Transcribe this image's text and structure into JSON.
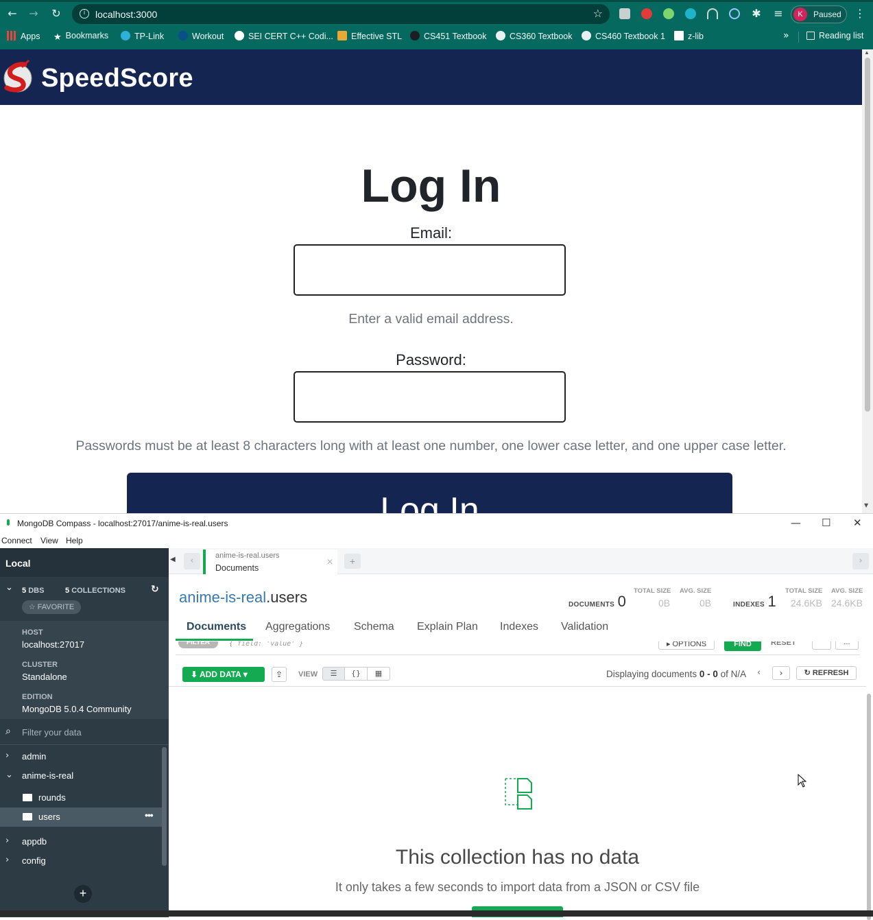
{
  "browser": {
    "url": "localhost:3000",
    "profile_initial": "K",
    "profile_status": "Paused",
    "bookmarks": [
      {
        "label": "Apps",
        "icon": "apps-grid-icon"
      },
      {
        "label": "Bookmarks",
        "icon": "star-icon"
      },
      {
        "label": "TP-Link",
        "icon": "tplink-icon"
      },
      {
        "label": "Workout",
        "icon": "workout-icon"
      },
      {
        "label": "SEI CERT C++ Codi...",
        "icon": "sei-icon"
      },
      {
        "label": "Effective STL",
        "icon": "book-icon"
      },
      {
        "label": "CS451 Textbook",
        "icon": "github-icon"
      },
      {
        "label": "CS360 Textbook",
        "icon": "globe-icon"
      },
      {
        "label": "CS460 Textbook 1",
        "icon": "globe-icon"
      },
      {
        "label": "z-lib",
        "icon": "zlib-icon"
      }
    ],
    "reading_list": "Reading list",
    "accent": "#05695f"
  },
  "site": {
    "brand": "SpeedScore",
    "navbar_color": "#152551",
    "title": "Log In",
    "email_label": "Email:",
    "email_help": "Enter a valid email address.",
    "password_label": "Password:",
    "password_help": "Passwords must be at least 8 characters long with at least one number, one lower case letter, and one upper case letter.",
    "login_button": "Log In"
  },
  "compass": {
    "window_title": "MongoDB Compass - localhost:27017/anime-is-real.users",
    "menu": [
      "Connect",
      "View",
      "Help"
    ],
    "sidebar": {
      "connection": "Local",
      "dbs_count": "5",
      "dbs_label": "DBS",
      "collections_count": "5",
      "collections_label": "COLLECTIONS",
      "favorite": "☆ FAVORITE",
      "host_label": "HOST",
      "host": "localhost:27017",
      "cluster_label": "CLUSTER",
      "cluster": "Standalone",
      "edition_label": "EDITION",
      "edition": "MongoDB 5.0.4 Community",
      "filter_placeholder": "Filter your data",
      "databases": [
        {
          "name": "admin",
          "expanded": false
        },
        {
          "name": "anime-is-real",
          "expanded": true,
          "collections": [
            "rounds",
            "users"
          ]
        },
        {
          "name": "appdb",
          "expanded": false
        },
        {
          "name": "config",
          "expanded": false
        }
      ]
    },
    "tab": {
      "namespace": "anime-is-real.users",
      "title": "Documents"
    },
    "header": {
      "db": "anime-is-real",
      "coll": ".users",
      "documents_label": "DOCUMENTS",
      "documents_count": "0",
      "doc_total_size_label": "TOTAL SIZE",
      "doc_total_size": "0B",
      "doc_avg_size_label": "AVG. SIZE",
      "doc_avg_size": "0B",
      "indexes_label": "INDEXES",
      "indexes_count": "1",
      "idx_total_size_label": "TOTAL SIZE",
      "idx_total_size": "24.6KB",
      "idx_avg_size_label": "AVG. SIZE",
      "idx_avg_size": "24.6KB"
    },
    "subtabs": [
      "Documents",
      "Aggregations",
      "Schema",
      "Explain Plan",
      "Indexes",
      "Validation"
    ],
    "query": {
      "filter_label": "FILTER",
      "filter_placeholder": "{ field: 'value' }",
      "options": "▸ OPTIONS",
      "find": "FIND",
      "reset": "RESET",
      "more": "..."
    },
    "toolbar": {
      "add_data": "ADD DATA",
      "view_label": "VIEW",
      "displaying_prefix": "Displaying documents ",
      "range": "0 - 0",
      "of": " of N/A",
      "refresh": "REFRESH"
    },
    "empty": {
      "title": "This collection has no data",
      "subtitle": "It only takes a few seconds to import data from a JSON or CSV file"
    },
    "accent": "#13aa52"
  }
}
